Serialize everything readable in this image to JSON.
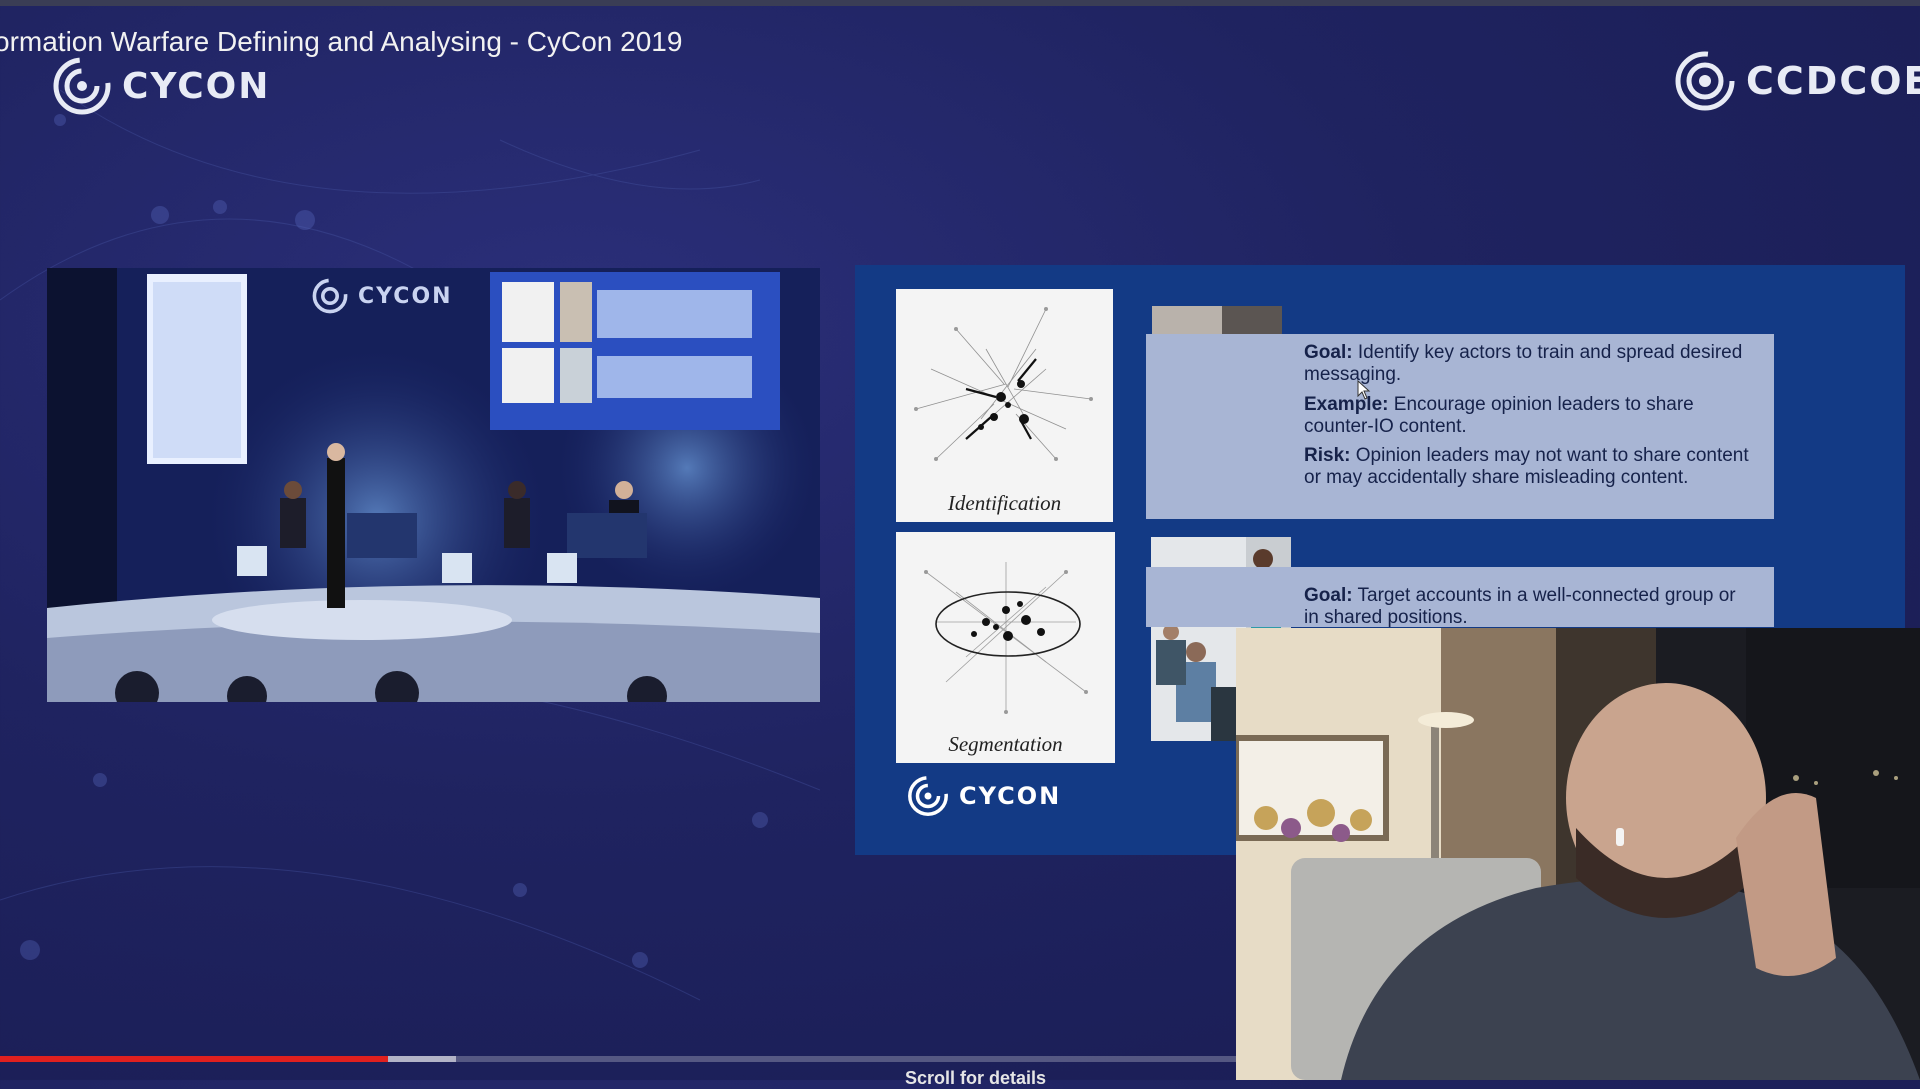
{
  "video": {
    "title": "ormation Warfare Defining and Analysing - CyCon 2019",
    "progress_fraction": 0.314,
    "buffered_fraction": 0.369,
    "scroll_hint": "Scroll for details"
  },
  "logos": {
    "left": "CYCON",
    "right": "CCDCOE",
    "stage_screen": "CYCON",
    "slide": "CYCON"
  },
  "slide": {
    "panels": [
      {
        "caption": "Identification"
      },
      {
        "caption": "Segmentation"
      }
    ],
    "box1": {
      "goal_label": "Goal:",
      "goal_text": "Identify key actors to train and spread desired messaging.",
      "example_label": "Example:",
      "example_text": "Encourage opinion leaders to share counter-IO content.",
      "risk_label": "Risk:",
      "risk_text": "Opinion leaders may not want to share content or may accidentally share misleading content."
    },
    "box2": {
      "goal_label": "Goal:",
      "goal_text": "Target accounts in a well-connected group or in shared positions."
    }
  },
  "colors": {
    "background": "#1f2360",
    "slide_background": "#133a85",
    "text_box": "#a8b5d4",
    "progress_played": "#e0201f"
  }
}
